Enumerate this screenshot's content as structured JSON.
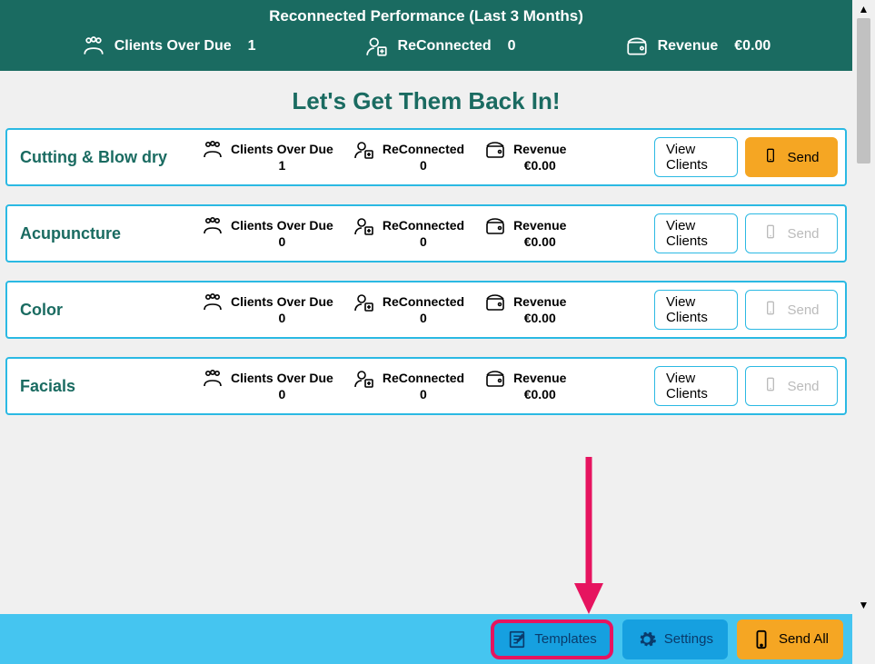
{
  "header": {
    "title": "Reconnected Performance (Last 3 Months)",
    "stats": {
      "overdue_label": "Clients Over Due",
      "overdue_value": "1",
      "reconnected_label": "ReConnected",
      "reconnected_value": "0",
      "revenue_label": "Revenue",
      "revenue_value": "€0.00"
    }
  },
  "subhead": "Let's Get Them Back In!",
  "labels": {
    "overdue": "Clients Over Due",
    "reconnected": "ReConnected",
    "revenue": "Revenue",
    "view": "View Clients",
    "send": "Send"
  },
  "categories": [
    {
      "name": "Cutting & Blow dry",
      "overdue": "1",
      "reconnected": "0",
      "revenue": "€0.00",
      "send_enabled": true
    },
    {
      "name": "Acupuncture",
      "overdue": "0",
      "reconnected": "0",
      "revenue": "€0.00",
      "send_enabled": false
    },
    {
      "name": "Color",
      "overdue": "0",
      "reconnected": "0",
      "revenue": "€0.00",
      "send_enabled": false
    },
    {
      "name": "Facials",
      "overdue": "0",
      "reconnected": "0",
      "revenue": "€0.00",
      "send_enabled": false
    }
  ],
  "footer": {
    "templates": "Templates",
    "settings": "Settings",
    "sendall": "Send All"
  },
  "annotation": {
    "arrow_color": "#e6145f"
  }
}
